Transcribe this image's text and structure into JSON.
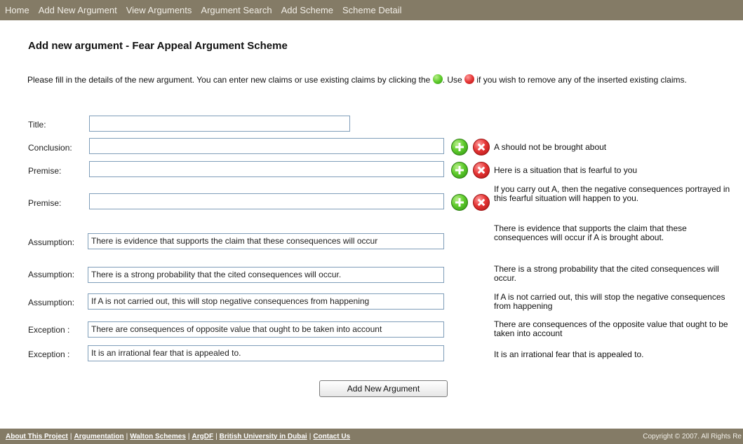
{
  "nav": {
    "items": [
      "Home",
      "Add New Argument",
      "View Arguments",
      "Argument Search",
      "Add Scheme",
      "Scheme Detail"
    ]
  },
  "page": {
    "title": "Add new argument - Fear Appeal Argument Scheme",
    "intro_part1": "Please fill in the details of the new argument. You can enter new claims or use existing claims by clicking the",
    "intro_part2": ". Use",
    "intro_part3": "if you wish to remove any of the inserted existing claims."
  },
  "form": {
    "title_label": "Title:",
    "title_value": "",
    "rows": [
      {
        "label": "Conclusion:",
        "value": "",
        "desc": "A should not be brought about"
      },
      {
        "label": "Premise:",
        "value": "",
        "desc": "Here is a situation that is fearful to you"
      },
      {
        "label": "Premise:",
        "value": "",
        "desc": "If you carry out A, then the negative consequences portrayed in this fearful situation will happen to you."
      },
      {
        "label": "Assumption:",
        "value": "There is evidence that supports the claim that these consequences will occur",
        "desc": "There is evidence that supports the claim that these consequences will occur if A is brought about."
      },
      {
        "label": "Assumption:",
        "value": "There is a strong probability that the cited consequences will occur.",
        "desc": "There is a strong probability that the cited consequences will occur."
      },
      {
        "label": "Assumption:",
        "value": "If A is not carried out, this will stop  negative consequences from happening",
        "desc": "If A is not carried out, this will stop the negative consequences from happening"
      },
      {
        "label": "Exception :",
        "value": "There are consequences of opposite value that ought to be taken into account",
        "desc": "There are consequences of the opposite value that ought to be taken into account"
      },
      {
        "label": "Exception :",
        "value": "It is an irrational fear that is appealed to.",
        "desc": "It is an irrational fear that is appealed to."
      }
    ],
    "submit_label": "Add New Argument"
  },
  "footer": {
    "links": [
      "About This Project",
      "Argumentation",
      "Walton Schemes",
      "ArgDF",
      "British University in Dubai",
      "Contact Us"
    ],
    "copyright": "Copyright © 2007. All Rights Re"
  },
  "colors": {
    "bar": "#847b66",
    "input_border": "#7f9db9"
  }
}
